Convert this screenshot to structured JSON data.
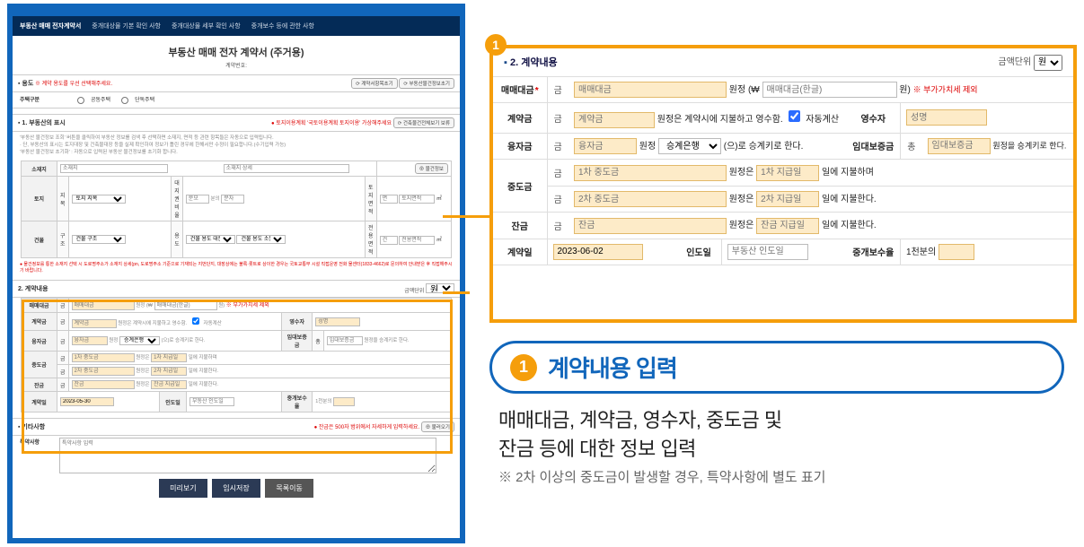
{
  "tabs": {
    "t0": "부동산 매매 전자계약서",
    "t1": "중개대상물 기본 확인 사항",
    "t2": "중개대상물 세부 확인 사항",
    "t3": "중개보수 등에 관한 사항"
  },
  "doc": {
    "title": "부동산 매매 전자 계약서 (주거용)",
    "sub": "계약번호:"
  },
  "yd": {
    "title": "▪ 용도",
    "warn": "※ 계약 용도를 우선 선택해주세요.",
    "btn_init": "⟳ 계약서항목초기",
    "btn_load": "⟳ 부동산물건정보초기",
    "row_label": "주택구분",
    "opt1": "공동주택",
    "opt2": "단독주택"
  },
  "pj": {
    "title": "▪ 1. 부동산의 표시",
    "info1": "● 토지이용계획 '국토이용계획 토지이용' 가상해주세요",
    "btn_info": "⟳ 건축물건전체보기 보류",
    "desc1": "'부동산 물건정보 조회' 버튼을 클릭하여 부동산 정보를 검색 후 선택하면 소재지, 면적 등 관련 항목들은 자동으로 입력됩니다.",
    "desc2": "· 단, 부동산의 표시는 토지대장 및 건축물대장 등을 실제 확인하여 정보가 틀린 경우에 한해서만 수정이 필요합니다.(수기입력 가능)",
    "desc3": "'부동산 물건정보 초기화' : 자동으로 입력된 부동산 물건정보를 초기화 합니다.",
    "row_addr": "소재지",
    "ph_addr1": "소재지",
    "ph_addr2": "소재지 상세",
    "btn_lookup": "⊕ 물건정보",
    "row_land": "토지",
    "l_jimok": "지목",
    "ph_jimok": "토지 지목",
    "l_ratio": "대지권비율",
    "ph_b1": "분모",
    "ph_b2": "분의",
    "ph_b3": "분자",
    "l_area_land": "토지면적",
    "ph_area1": "면",
    "ph_area2": "토지면적",
    "row_bldg": "건물",
    "l_struct": "구조",
    "ph_struct": "건물 구조",
    "l_use": "용도",
    "ph_use1": "건물 용도 대분류",
    "ph_use2": "건물 용도 소분류",
    "l_area_bldg": "전용면적",
    "ph_area3": "건",
    "ph_area4": "전용면적",
    "warn_addr": "● 물건정보를 통한 소재지 선택 시 도로명주소가 소재지 상세(pn, 도로명주소 기준으로 기재되는 지번단지, 대장상에는 불록·롯트로 상이한 경우는 국토교통부 시설 직접운영 전화 물센터(1833-4662)로 문의하여 안내받은 후 직접해주시기 바랍니다."
  },
  "ct_small": {
    "title": "2. 계약내용",
    "unit_lbl": "금액단위",
    "unit_opt": "원"
  },
  "contract": {
    "section": "2. 계약내용",
    "unit_lbl": "금액단위",
    "unit_opt": "원",
    "rows": {
      "mm": {
        "h": "매매대금",
        "sub": "금",
        "ph1": "매매대금",
        "mid": "원정  (₩",
        "ph2": "매매대금(한글)",
        "tail": "원)",
        "note": "※ 부가가치세 제외"
      },
      "cg": {
        "h": "계약금",
        "sub": "금",
        "ph1": "계약금",
        "tail1": "원정은 계약시에 지불하고 영수함.",
        "auto": "자동계산",
        "r_h": "영수자",
        "r_ph": "성명"
      },
      "yz": {
        "h": "융자금",
        "sub": "금",
        "ph1": "융자금",
        "mid": "원정",
        "sel": "승계은행",
        "tail": "(으)로 승계키로 한다.",
        "r_h": "임대보증금",
        "r_sub": "총",
        "r_ph": "임대보증금",
        "r_tail": "원정을 승계키로 한다."
      },
      "jd1": {
        "h": "중도금",
        "sub": "금",
        "ph1": "1차 중도금",
        "mid": "원정은",
        "ph2": "1차 지급일",
        "tail": "일에 지불하며"
      },
      "jd2": {
        "sub": "금",
        "ph1": "2차 중도금",
        "mid": "원정은",
        "ph2": "2차 지급일",
        "tail": "일에 지불한다."
      },
      "jg": {
        "h": "잔금",
        "sub": "금",
        "ph1": "잔금",
        "mid": "원정은",
        "ph2": "잔금 지급일",
        "tail": "일에 지불한다."
      },
      "cd": {
        "h": "계약일",
        "val": "2023-06-02",
        "r1_h": "인도일",
        "r1_ph": "부동산 인도일",
        "r2_h": "중개보수율",
        "r2_ph": "1천분의"
      }
    }
  },
  "etc": {
    "title": "▪ 기타사항",
    "info": "● 잔금은 500자 범위에서 자세하게 입력하세요.",
    "btn": "⊕ 불러오기",
    "row": "특약사항",
    "ph": "특약사항 입력"
  },
  "actions": {
    "b1": "미리보기",
    "b2": "임시저장",
    "b3": "목록이동"
  },
  "ct_small_date": "2023-05-30",
  "explain": {
    "num": "1",
    "title": "계약내용 입력",
    "body1": "매매대금, 계약금, 영수자, 중도금 및",
    "body2": "잔금 등에 대한 정보 입력",
    "note": "※ 2차 이상의 중도금이 발생할 경우, 특약사항에 별도 표기"
  }
}
